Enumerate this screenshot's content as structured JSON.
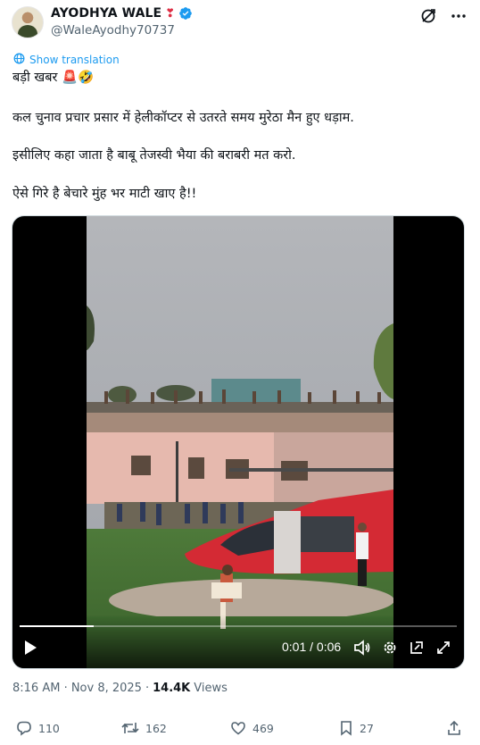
{
  "author": {
    "display_name": "AYODHYA WALE",
    "name_emoji": "❣",
    "verified": true,
    "handle": "@WaleAyodhy70737"
  },
  "header_icons": [
    "grok-icon",
    "more-icon"
  ],
  "show_translation": "Show translation",
  "post": {
    "line1": "बड़ी खबर 🚨🤣",
    "line2": "कल चुनाव प्रचार प्रसार में हेलीकॉप्टर से उतरते समय मुरेठा मैन हुए धड़ाम.",
    "line3": "इसीलिए कहा जाता है बाबू तेजस्वी भैया की बराबरी मत करो.",
    "line4": "ऐसे गिरे है बेचारे मुंह भर माटी खाए है!!"
  },
  "video": {
    "time": "0:01 / 0:06",
    "progress": 0.17
  },
  "meta": {
    "timestamp": "8:16 AM · Nov 8, 2025",
    "separator": "·",
    "views_count": "14.4K",
    "views_label": "Views"
  },
  "actions": {
    "replies": "110",
    "reposts": "162",
    "likes": "469",
    "bookmarks": "27"
  },
  "colors": {
    "accent": "#1d9bf0",
    "muted": "#536471",
    "text": "#0f1419"
  }
}
